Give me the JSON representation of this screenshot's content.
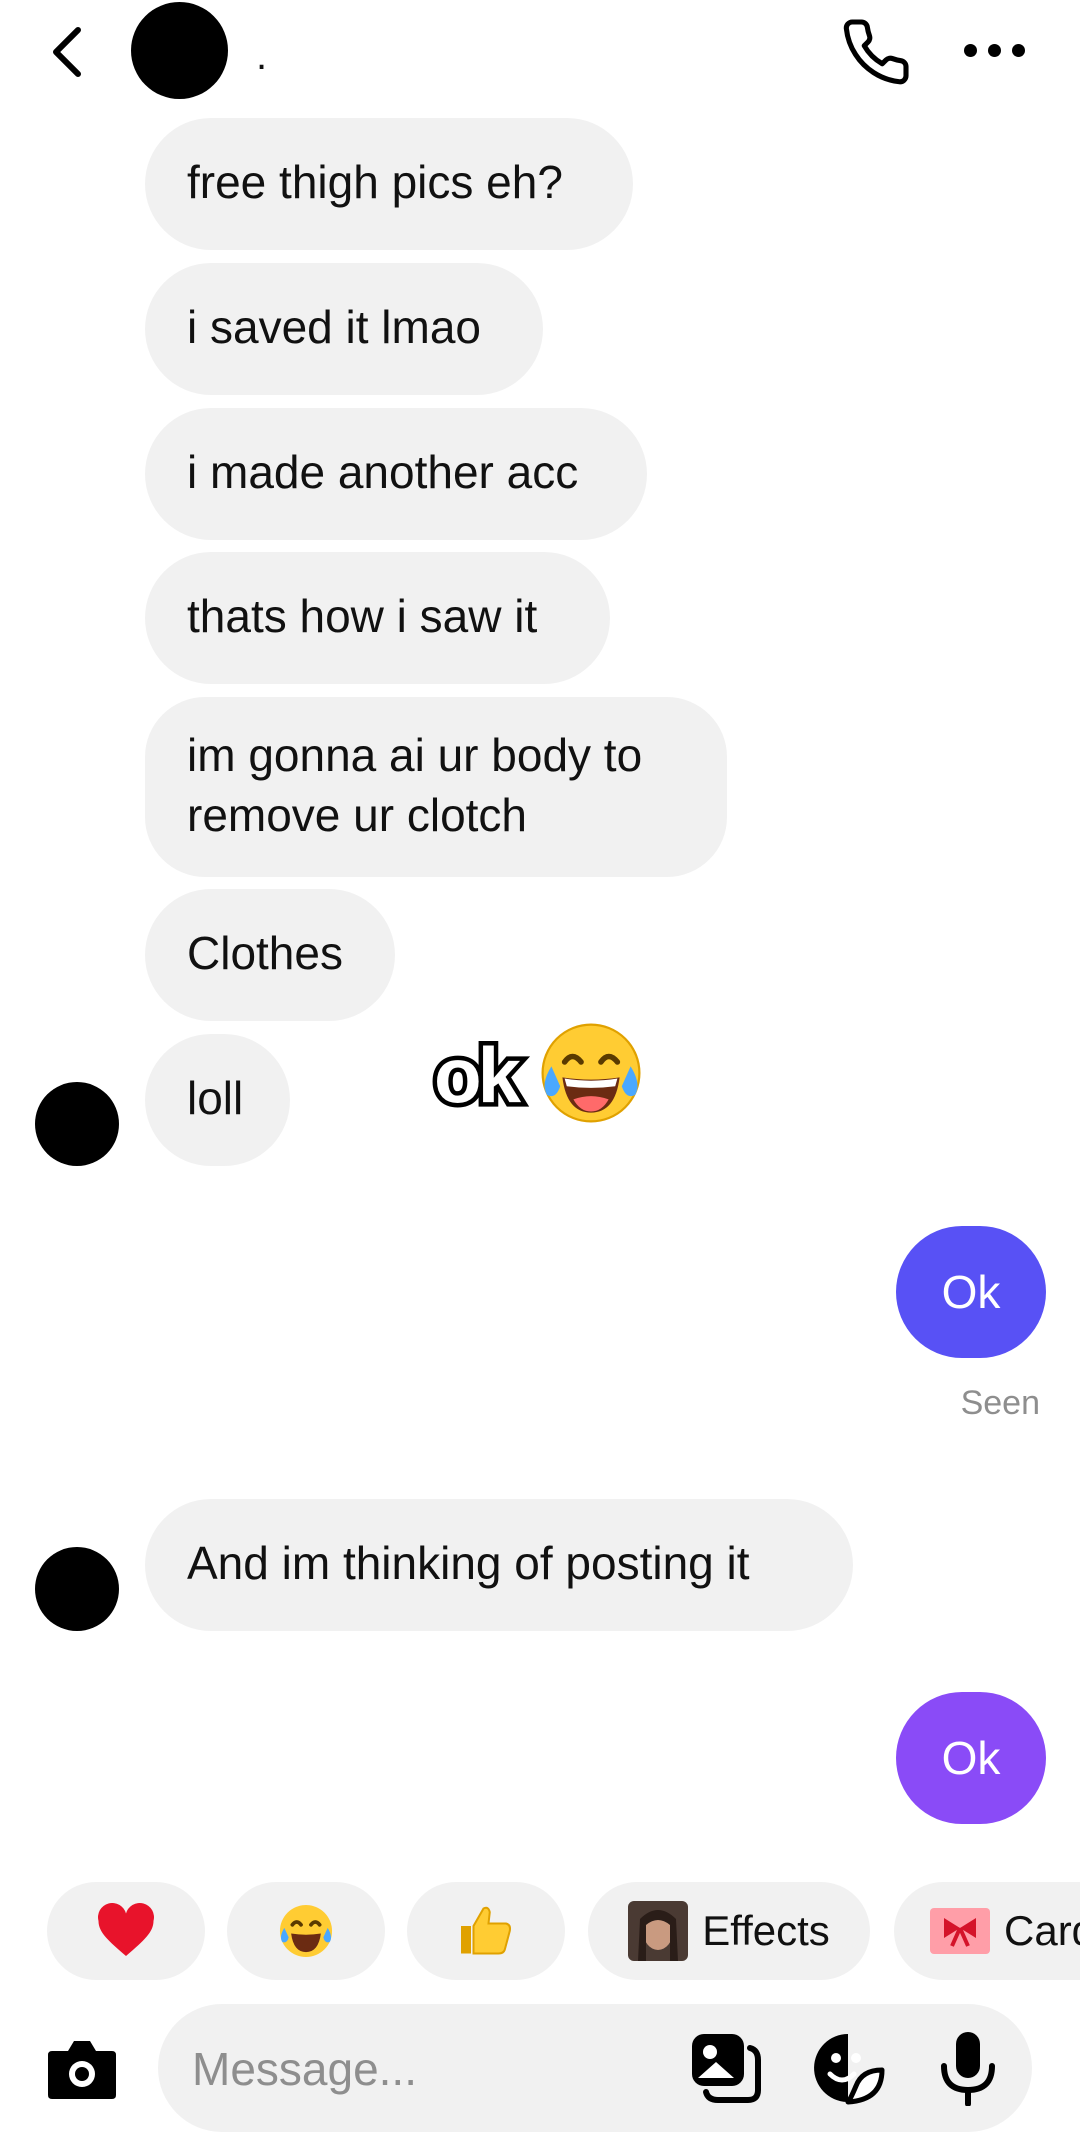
{
  "header": {
    "name": ".",
    "icons": {
      "back": "chevron-left-icon",
      "call": "phone-icon",
      "more": "more-horizontal-icon"
    }
  },
  "messages": {
    "incoming_1": [
      "free thigh pics eh?",
      "i saved it lmao",
      "i made another acc",
      "thats how i saw it",
      "im gonna ai ur body to remove ur clotch",
      "Clothes",
      "loll"
    ],
    "outgoing_1": "Ok",
    "seen": "Seen",
    "incoming_2": "And im thinking of posting it",
    "outgoing_2": "Ok",
    "sticker_text": "ok"
  },
  "quick_reactions": {
    "items": [
      "heart-emoji",
      "tears-of-joy-emoji",
      "thumbs-up-emoji"
    ],
    "effects_label": "Effects",
    "cards_label": "Card"
  },
  "composer": {
    "placeholder": "Message..."
  },
  "colors": {
    "outgoing_1": "#5851f5",
    "outgoing_2": "#8a4bf7",
    "incoming": "#f1f1f1"
  }
}
